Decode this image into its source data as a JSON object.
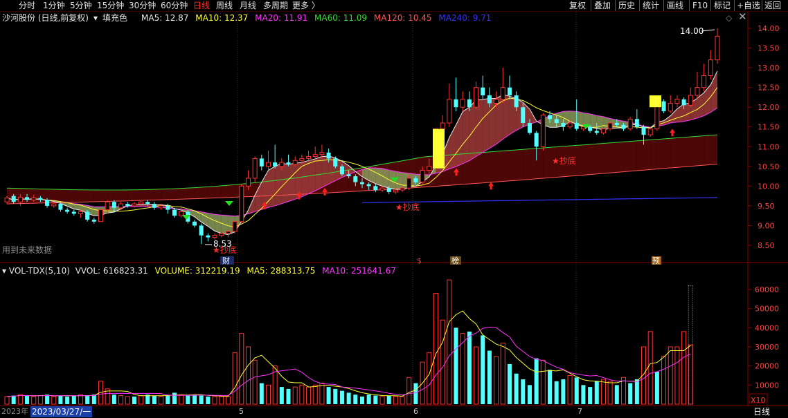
{
  "window": {
    "tabs": [
      "分时",
      "1分钟",
      "5分钟",
      "15分钟",
      "30分钟",
      "60分钟",
      "日线",
      "周线",
      "月线",
      "多周期",
      "更多 〉"
    ],
    "active_tab": "日线",
    "right_buttons": [
      "复权",
      "叠加",
      "历史",
      "统计",
      "画线",
      "F10",
      "标记",
      "+自选",
      "返回"
    ]
  },
  "main_panel": {
    "title": "沙河股份 (日线,前复权)",
    "fill_label": "填充色",
    "ma_labels": [
      {
        "text": "MA5: 12.87",
        "color": "#e8e8e8"
      },
      {
        "text": "MA10: 12.37",
        "color": "#ffff33"
      },
      {
        "text": "MA20: 11.91",
        "color": "#ff33ff"
      },
      {
        "text": "MA60: 11.09",
        "color": "#33dd33"
      },
      {
        "text": "MA120: 10.45",
        "color": "#ff5555"
      },
      {
        "text": "MA240: 9.71",
        "color": "#3333ff"
      }
    ],
    "future_data_label": "用到未来数据",
    "markers": {
      "high": "14.00",
      "low": "8.53",
      "chaodi": "★抄底",
      "cai": "财",
      "s": "$",
      "bang": "榜",
      "yu": "预"
    }
  },
  "volume_panel": {
    "title": "VOL-TDX(5,10)",
    "labels": [
      {
        "text": "VVOL: 616823.31",
        "color": "#e8e8e8"
      },
      {
        "text": "VOLUME: 312219.19",
        "color": "#ffff33"
      },
      {
        "text": "MA5: 288313.75",
        "color": "#ffff33"
      },
      {
        "text": "MA10: 251641.67",
        "color": "#ff33ff"
      }
    ],
    "x10": "X10"
  },
  "bottom": {
    "year_label": "2023年",
    "cursor_date": "2023/03/27/一",
    "month_labels": [
      "5",
      "6",
      "7"
    ],
    "period_label": "日线"
  },
  "chart_data": {
    "type": "candlestick",
    "price_axis": {
      "ticks": [
        8.5,
        9.0,
        9.5,
        10.0,
        10.5,
        11.0,
        11.5,
        12.0,
        12.5,
        13.0,
        13.5,
        14.0
      ],
      "range": [
        8.2,
        14.3
      ]
    },
    "volume_axis": {
      "ticks": [
        10000,
        20000,
        30000,
        40000,
        50000,
        60000
      ],
      "range": [
        0,
        67000
      ]
    },
    "candles": [
      [
        9.6,
        9.7,
        9.55,
        9.75
      ],
      [
        9.75,
        9.6,
        9.55,
        9.8
      ],
      [
        9.6,
        9.72,
        9.5,
        9.8
      ],
      [
        9.72,
        9.65,
        9.6,
        9.8
      ],
      [
        9.65,
        9.7,
        9.6,
        9.78
      ],
      [
        9.7,
        9.65,
        9.6,
        9.75
      ],
      [
        9.65,
        9.5,
        9.45,
        9.7
      ],
      [
        9.5,
        9.55,
        9.45,
        9.6
      ],
      [
        9.55,
        9.4,
        9.35,
        9.6
      ],
      [
        9.4,
        9.35,
        9.3,
        9.45
      ],
      [
        9.35,
        9.3,
        9.25,
        9.4
      ],
      [
        9.3,
        9.35,
        9.2,
        9.4
      ],
      [
        9.35,
        9.15,
        9.1,
        9.4
      ],
      [
        9.15,
        9.1,
        9.05,
        9.2
      ],
      [
        9.1,
        9.4,
        9.1,
        9.45
      ],
      [
        9.4,
        9.6,
        9.3,
        9.65
      ],
      [
        9.6,
        9.45,
        9.35,
        9.65
      ],
      [
        9.45,
        9.55,
        9.4,
        9.6
      ],
      [
        9.55,
        9.5,
        9.45,
        9.6
      ],
      [
        9.5,
        9.55,
        9.45,
        9.6
      ],
      [
        9.55,
        9.6,
        9.5,
        9.65
      ],
      [
        9.6,
        9.55,
        9.5,
        9.65
      ],
      [
        9.55,
        9.45,
        9.4,
        9.6
      ],
      [
        9.45,
        9.5,
        9.4,
        9.55
      ],
      [
        9.5,
        9.4,
        9.3,
        9.55
      ],
      [
        9.4,
        9.25,
        9.2,
        9.45
      ],
      [
        9.25,
        9.35,
        9.2,
        9.5
      ],
      [
        9.35,
        9.1,
        9.05,
        9.4
      ],
      [
        9.1,
        9.0,
        8.95,
        9.15
      ],
      [
        9.0,
        8.75,
        8.53,
        9.05
      ],
      [
        8.75,
        8.7,
        8.6,
        8.8
      ],
      [
        8.7,
        8.75,
        8.65,
        8.8
      ],
      [
        8.75,
        8.8,
        8.7,
        8.85
      ],
      [
        8.8,
        8.85,
        8.7,
        8.9
      ],
      [
        8.85,
        9.1,
        8.8,
        9.15
      ],
      [
        9.1,
        10.0,
        9.05,
        10.05
      ],
      [
        10.0,
        10.2,
        9.9,
        10.4
      ],
      [
        10.2,
        10.7,
        10.1,
        10.75
      ],
      [
        10.7,
        10.5,
        10.4,
        10.8
      ],
      [
        10.5,
        10.6,
        10.4,
        10.9
      ],
      [
        10.6,
        10.5,
        10.45,
        11.05
      ],
      [
        10.5,
        10.6,
        10.4,
        10.7
      ],
      [
        10.6,
        10.55,
        10.5,
        10.8
      ],
      [
        10.55,
        10.65,
        10.5,
        10.75
      ],
      [
        10.65,
        10.7,
        10.55,
        10.8
      ],
      [
        10.7,
        10.75,
        10.6,
        10.9
      ],
      [
        10.75,
        10.8,
        10.65,
        11.0
      ],
      [
        10.8,
        10.85,
        10.7,
        11.05
      ],
      [
        10.85,
        10.7,
        10.6,
        10.95
      ],
      [
        10.7,
        10.5,
        10.45,
        10.75
      ],
      [
        10.5,
        10.3,
        10.25,
        10.55
      ],
      [
        10.3,
        10.25,
        10.2,
        10.4
      ],
      [
        10.25,
        10.1,
        10.0,
        10.3
      ],
      [
        10.1,
        10.05,
        9.95,
        10.2
      ],
      [
        10.05,
        10.0,
        9.9,
        10.1
      ],
      [
        10.0,
        9.9,
        9.85,
        10.05
      ],
      [
        9.9,
        9.95,
        9.85,
        10.0
      ],
      [
        9.95,
        9.85,
        9.8,
        10.0
      ],
      [
        9.85,
        9.9,
        9.8,
        10.0
      ],
      [
        9.9,
        9.95,
        9.85,
        10.0
      ],
      [
        9.95,
        10.2,
        9.9,
        10.3
      ],
      [
        10.2,
        10.1,
        10.05,
        10.25
      ],
      [
        10.1,
        10.4,
        10.05,
        10.5
      ],
      [
        10.4,
        10.5,
        10.3,
        10.7
      ],
      [
        10.5,
        11.45,
        10.45,
        11.45
      ],
      [
        11.45,
        11.6,
        11.3,
        11.8
      ],
      [
        11.6,
        12.2,
        11.5,
        12.6
      ],
      [
        12.2,
        12.0,
        11.9,
        12.75
      ],
      [
        12.0,
        12.2,
        11.9,
        12.4
      ],
      [
        12.2,
        12.0,
        11.9,
        12.4
      ],
      [
        12.0,
        12.5,
        11.95,
        12.65
      ],
      [
        12.5,
        12.3,
        12.2,
        12.8
      ],
      [
        12.3,
        12.1,
        12.0,
        12.5
      ],
      [
        12.1,
        12.2,
        12.0,
        12.4
      ],
      [
        12.2,
        12.5,
        12.1,
        13.0
      ],
      [
        12.5,
        12.3,
        12.2,
        12.8
      ],
      [
        12.3,
        12.0,
        11.9,
        12.4
      ],
      [
        12.0,
        11.6,
        11.5,
        12.1
      ],
      [
        11.6,
        11.35,
        11.3,
        11.7
      ],
      [
        11.35,
        11.0,
        10.65,
        11.4
      ],
      [
        11.0,
        11.8,
        10.9,
        11.85
      ],
      [
        11.8,
        11.7,
        11.6,
        11.9
      ],
      [
        11.7,
        11.6,
        11.5,
        11.8
      ],
      [
        11.6,
        11.5,
        11.4,
        11.7
      ],
      [
        11.5,
        11.6,
        11.45,
        11.7
      ],
      [
        11.6,
        11.45,
        11.4,
        12.2
      ],
      [
        11.45,
        11.5,
        11.4,
        11.6
      ],
      [
        11.5,
        11.4,
        11.35,
        11.55
      ],
      [
        11.4,
        11.35,
        11.3,
        11.6
      ],
      [
        11.35,
        11.45,
        11.3,
        11.5
      ],
      [
        11.45,
        11.6,
        11.4,
        11.65
      ],
      [
        11.6,
        11.55,
        11.5,
        11.7
      ],
      [
        11.55,
        11.45,
        11.4,
        11.6
      ],
      [
        11.45,
        11.7,
        11.4,
        11.75
      ],
      [
        11.7,
        11.5,
        11.45,
        11.95
      ],
      [
        11.5,
        11.3,
        11.05,
        11.55
      ],
      [
        11.3,
        11.45,
        11.25,
        11.5
      ],
      [
        11.45,
        12.15,
        11.4,
        12.2
      ],
      [
        12.15,
        11.9,
        11.85,
        12.2
      ],
      [
        11.9,
        12.1,
        11.85,
        12.3
      ],
      [
        12.1,
        12.2,
        12.0,
        12.3
      ],
      [
        12.2,
        12.05,
        11.95,
        12.25
      ],
      [
        12.05,
        12.3,
        12.0,
        12.5
      ],
      [
        12.3,
        12.5,
        12.2,
        12.9
      ],
      [
        12.5,
        12.8,
        12.4,
        13.1
      ],
      [
        12.8,
        13.2,
        12.7,
        13.45
      ],
      [
        13.2,
        13.8,
        13.1,
        14.0
      ]
    ],
    "volume": [
      [
        4000,
        1
      ],
      [
        4500,
        0
      ],
      [
        5000,
        1
      ],
      [
        4500,
        0
      ],
      [
        4000,
        1
      ],
      [
        4500,
        1
      ],
      [
        5000,
        0
      ],
      [
        4000,
        1
      ],
      [
        4500,
        0
      ],
      [
        4000,
        0
      ],
      [
        4500,
        0
      ],
      [
        5000,
        1
      ],
      [
        4500,
        0
      ],
      [
        5000,
        0
      ],
      [
        12000,
        1
      ],
      [
        8000,
        1
      ],
      [
        5000,
        0
      ],
      [
        4500,
        1
      ],
      [
        4000,
        1
      ],
      [
        4000,
        0
      ],
      [
        4500,
        1
      ],
      [
        5000,
        0
      ],
      [
        4500,
        0
      ],
      [
        4000,
        1
      ],
      [
        4500,
        0
      ],
      [
        6000,
        0
      ],
      [
        5000,
        1
      ],
      [
        4500,
        0
      ],
      [
        5000,
        0
      ],
      [
        4500,
        0
      ],
      [
        4000,
        0
      ],
      [
        4000,
        1
      ],
      [
        4000,
        1
      ],
      [
        4000,
        1
      ],
      [
        27000,
        1
      ],
      [
        37000,
        1
      ],
      [
        30000,
        1
      ],
      [
        23000,
        1
      ],
      [
        11000,
        0
      ],
      [
        10000,
        1
      ],
      [
        20000,
        1
      ],
      [
        9000,
        0
      ],
      [
        8000,
        0
      ],
      [
        9000,
        1
      ],
      [
        10000,
        1
      ],
      [
        9000,
        1
      ],
      [
        10000,
        1
      ],
      [
        11000,
        1
      ],
      [
        9000,
        0
      ],
      [
        8000,
        0
      ],
      [
        7000,
        0
      ],
      [
        6000,
        0
      ],
      [
        5000,
        0
      ],
      [
        4000,
        0
      ],
      [
        5000,
        0
      ],
      [
        4500,
        0
      ],
      [
        4000,
        1
      ],
      [
        4500,
        0
      ],
      [
        4000,
        1
      ],
      [
        4000,
        1
      ],
      [
        14000,
        1
      ],
      [
        11000,
        0
      ],
      [
        22000,
        1
      ],
      [
        27000,
        1
      ],
      [
        58000,
        1
      ],
      [
        44000,
        1
      ],
      [
        65000,
        1
      ],
      [
        40000,
        0
      ],
      [
        37000,
        1
      ],
      [
        38000,
        0
      ],
      [
        30000,
        1
      ],
      [
        36000,
        0
      ],
      [
        28000,
        0
      ],
      [
        25000,
        1
      ],
      [
        32000,
        1
      ],
      [
        21000,
        0
      ],
      [
        16000,
        0
      ],
      [
        13000,
        0
      ],
      [
        10000,
        0
      ],
      [
        24000,
        0
      ],
      [
        23000,
        1
      ],
      [
        18000,
        0
      ],
      [
        12000,
        0
      ],
      [
        13000,
        0
      ],
      [
        15000,
        1
      ],
      [
        14000,
        0
      ],
      [
        10000,
        0
      ],
      [
        9000,
        0
      ],
      [
        12000,
        0
      ],
      [
        13000,
        1
      ],
      [
        12000,
        1
      ],
      [
        10000,
        0
      ],
      [
        14000,
        1
      ],
      [
        11000,
        0
      ],
      [
        13000,
        0
      ],
      [
        30000,
        1
      ],
      [
        38000,
        1
      ],
      [
        17000,
        0
      ],
      [
        25000,
        1
      ],
      [
        30000,
        1
      ],
      [
        30000,
        1
      ],
      [
        38000,
        1
      ],
      [
        31000,
        1
      ]
    ]
  }
}
